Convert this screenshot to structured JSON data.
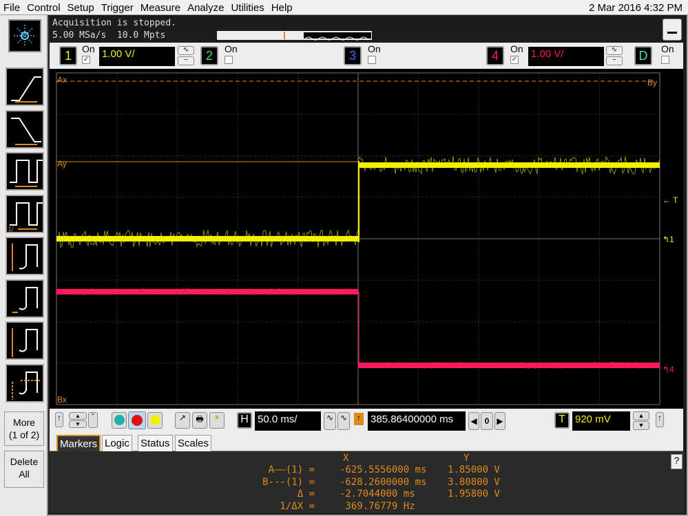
{
  "menu": [
    "File",
    "Control",
    "Setup",
    "Trigger",
    "Measure",
    "Analyze",
    "Utilities",
    "Help"
  ],
  "datetime": "2 Mar 2016  4:32 PM",
  "status": {
    "line1": "Acquisition is stopped.",
    "line2": "5.00 MSa/s  10.0 Mpts"
  },
  "channels": [
    {
      "num": "1",
      "on_label": "On",
      "checked": true,
      "scale": "1.00 V/",
      "color": "#f0f000"
    },
    {
      "num": "2",
      "on_label": "On",
      "checked": false,
      "color": "#40e040"
    },
    {
      "num": "3",
      "on_label": "On",
      "checked": false,
      "color": "#4060ff"
    },
    {
      "num": "4",
      "on_label": "On",
      "checked": true,
      "scale": "1.00 V/",
      "color": "#ff1a5a"
    },
    {
      "num": "D",
      "on_label": "On",
      "checked": false,
      "color": "#30e0c0"
    }
  ],
  "grid_labels": {
    "ax": "Ax",
    "ay": "Ay",
    "bx": "Bx",
    "by": "By",
    "trigger": "T",
    "ch1_marker": "1",
    "ch4_marker": "4"
  },
  "sidebar": {
    "more": "More\n(1 of 2)",
    "delete": "Delete\nAll"
  },
  "controls": {
    "timebase_label": "H",
    "timebase": "50.0 ms/",
    "delay": "385.86400000 ms",
    "delay_zero": "0",
    "trigger_label": "T",
    "trigger_level": "920 mV"
  },
  "tabs": [
    "Markers",
    "Logic",
    "Status",
    "Scales"
  ],
  "active_tab": "Markers",
  "markers": {
    "x_header": "X",
    "y_header": "Y",
    "rows": [
      {
        "label": "A——(1) =",
        "x": "-625.5556000 ms",
        "y": "1.85000 V"
      },
      {
        "label": "B---(1) =",
        "x": "-628.2600000 ms",
        "y": "3.80800 V"
      },
      {
        "label": "Δ =",
        "x": "-2.7044000 ms",
        "y": "1.95800 V"
      },
      {
        "label": "1/ΔX =",
        "x": " 369.76779 Hz",
        "y": ""
      }
    ]
  },
  "colors": {
    "accent": "#e08a1a",
    "ch1": "#f0f000",
    "ch4": "#ff1a5a"
  }
}
